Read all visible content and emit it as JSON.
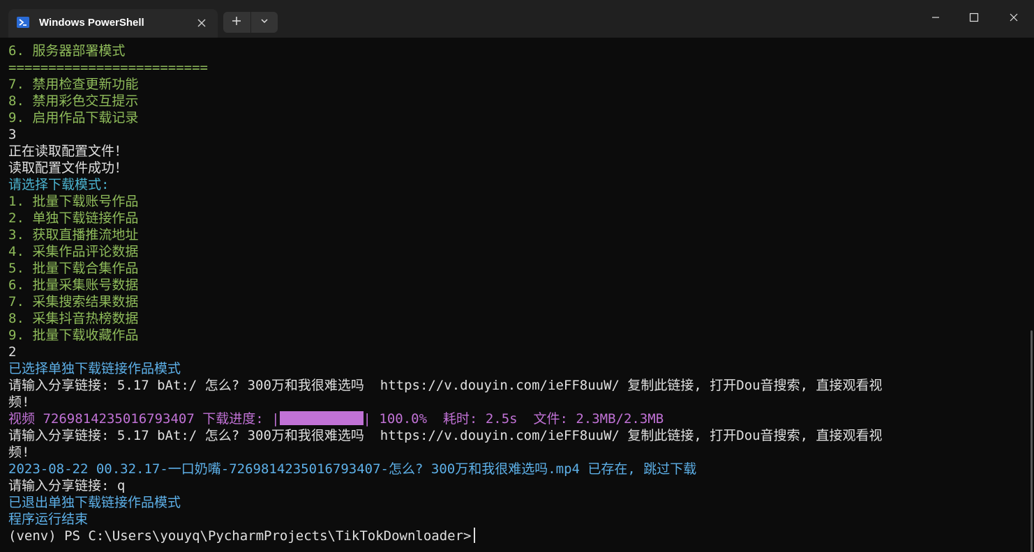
{
  "window": {
    "tab_title": "Windows PowerShell",
    "icons": {
      "tab": "powershell-icon",
      "close_tab": "close-icon",
      "new_tab": "plus-icon",
      "dropdown": "chevron-down-icon",
      "minimize": "minimize-icon",
      "maximize": "maximize-icon",
      "close_window": "close-icon"
    }
  },
  "colors": {
    "green": "#8fbc5a",
    "white": "#e0e0e0",
    "cyan": "#4cb4d0",
    "blue": "#5db0e8",
    "magenta": "#c172d6",
    "background": "#0c0c0c"
  },
  "terminal": {
    "config_menu": [
      "6. 服务器部署模式",
      "=========================",
      "7. 禁用检查更新功能",
      "8. 禁用彩色交互提示",
      "9. 启用作品下载记录"
    ],
    "input_1": "3",
    "reading_config": "正在读取配置文件！",
    "read_success": "读取配置文件成功！",
    "choose_mode_prompt": "请选择下载模式:",
    "mode_menu": [
      "1. 批量下载账号作品",
      "2. 单独下载链接作品",
      "3. 获取直播推流地址",
      "4. 采集作品评论数据",
      "5. 批量下载合集作品",
      "6. 批量采集账号数据",
      "7. 采集搜索结果数据",
      "8. 采集抖音热榜数据",
      "9. 批量下载收藏作品"
    ],
    "input_2": "2",
    "selected_mode": "已选择单独下载链接作品模式",
    "share_input_1_a": "请输入分享链接: 5.17 bAt:/ 怎么? 300万和我很难选吗  https://v.douyin.com/ieFF8uuW/ 复制此链接, 打开Dou音搜索, 直接观看视",
    "share_input_1_b": "频!",
    "progress_prefix": "视频 7269814235016793407 下载进度: |",
    "progress_fraction": 1.0,
    "progress_suffix": "| 100.0%  耗时: 2.5s  文件: 2.3MB/2.3MB",
    "share_input_2_a": "请输入分享链接: 5.17 bAt:/ 怎么? 300万和我很难选吗  https://v.douyin.com/ieFF8uuW/ 复制此链接, 打开Dou音搜索, 直接观看视",
    "share_input_2_b": "频!",
    "exists_skip": "2023-08-22 00.32.17-一口奶嘴-7269814235016793407-怎么? 300万和我很难选吗.mp4 已存在, 跳过下载",
    "share_input_3": "请输入分享链接: q",
    "exited_mode": "已退出单独下载链接作品模式",
    "program_end": "程序运行结束",
    "prompt": "(venv) PS C:\\Users\\youyq\\PycharmProjects\\TikTokDownloader>"
  }
}
